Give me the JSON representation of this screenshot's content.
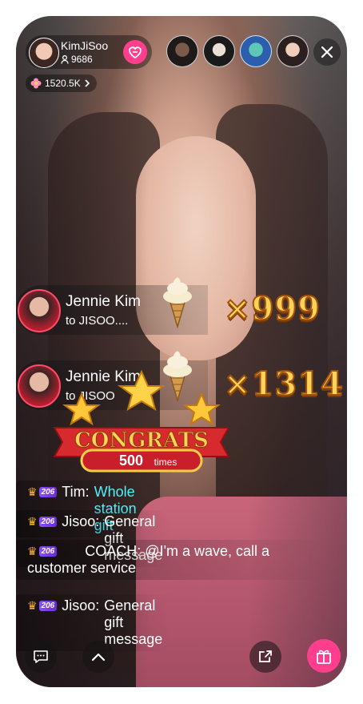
{
  "host": {
    "name": "KimJiSoo",
    "fans": "9686"
  },
  "popularity": "1520.5K",
  "gifts": [
    {
      "sender": "Jennie Kim",
      "to": "to JISOO....",
      "combo": "×999"
    },
    {
      "sender": "Jennie Kim",
      "to": "to JISOO",
      "combo": "×1314"
    }
  ],
  "congrats": {
    "title": "CONGRATS",
    "count": "500",
    "unit": "times"
  },
  "chat": [
    {
      "level": "206",
      "user": "Tim:",
      "message": "Whole station gift",
      "highlight": true
    },
    {
      "level": "206",
      "user": "Jisoo:",
      "message": "General gift message",
      "highlight": false
    },
    {
      "level": "206",
      "user": "COACH:",
      "message": "@I'm a wave, call a customer service",
      "highlight": false
    },
    {
      "level": "206",
      "user": "Jisoo:",
      "message": "General gift message",
      "highlight": false
    }
  ],
  "colors": {
    "accent": "#ff3f8e",
    "highlight": "#4ff0ff",
    "gold": "#ffd35a"
  },
  "icons": [
    "heart-follow-icon",
    "close-icon",
    "crown-icon",
    "chat-icon",
    "chevron-up-icon",
    "share-icon",
    "gift-icon"
  ]
}
